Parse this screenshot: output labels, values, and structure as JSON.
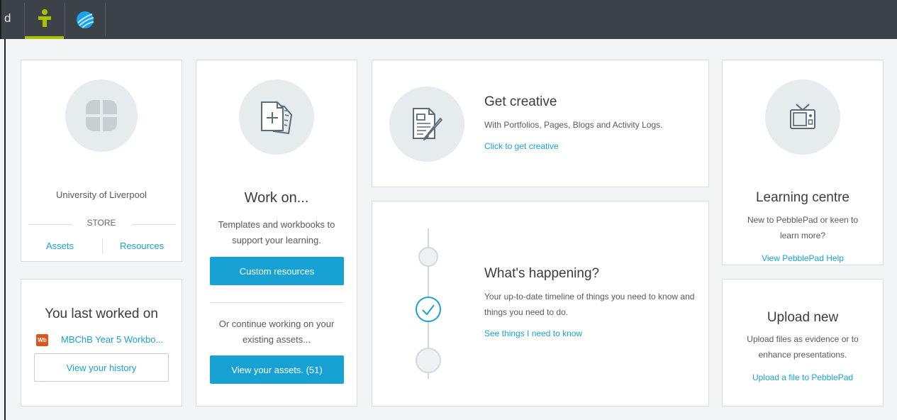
{
  "topbar": {
    "cut_text": "d",
    "tabs": [
      {
        "icon": "person-icon",
        "active": true,
        "color": "#a8c200"
      },
      {
        "icon": "globe-icon",
        "active": false,
        "color": "#1aa3ee"
      }
    ]
  },
  "store_card": {
    "institution": "University of Liverpool",
    "store_label": "STORE",
    "assets_link": "Assets",
    "resources_link": "Resources",
    "icon": "clover-icon"
  },
  "last_worked": {
    "title": "You last worked on",
    "badge": "Wb",
    "item": "MBChB Year 5 Workbo...",
    "history_button": "View your history"
  },
  "work_on": {
    "icon": "new-document-icon",
    "title": "Work on...",
    "description": "Templates and workbooks to support your learning.",
    "custom_button": "Custom resources",
    "continue_text": "Or continue working on your existing assets...",
    "assets_button": "View your assets. (51)"
  },
  "creative": {
    "icon": "document-brush-icon",
    "title": "Get creative",
    "description": "With Portfolios, Pages, Blogs and Activity Logs.",
    "link": "Click to get creative"
  },
  "happening": {
    "icon": "timeline-icon",
    "title": "What's happening?",
    "description": "Your up-to-date timeline of things you need to know and things you need to do.",
    "link": "See things I need to know"
  },
  "learning": {
    "icon": "tv-icon",
    "title": "Learning centre",
    "description": "New to PebblePad or keen to learn more?",
    "link": "View PebblePad Help"
  },
  "upload": {
    "title": "Upload new",
    "description": "Upload files as evidence or to enhance presentations.",
    "link": "Upload a file to PebblePad"
  },
  "colors": {
    "accent": "#17a2d3",
    "topbar": "#3c4248",
    "badge": "#d9561f"
  }
}
